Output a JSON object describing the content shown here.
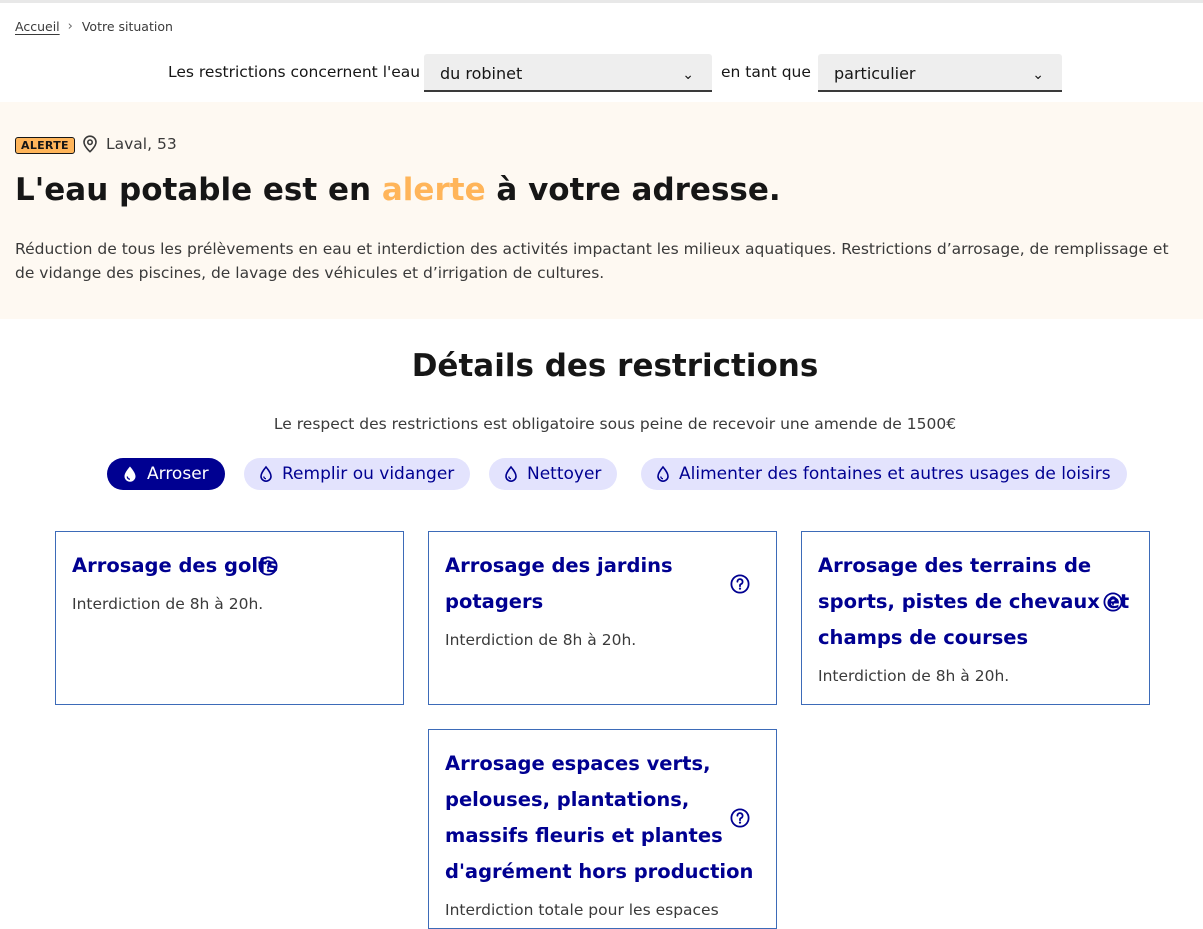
{
  "breadcrumb": {
    "home": "Accueil",
    "current": "Votre situation"
  },
  "filters": {
    "prefix": "Les restrictions concernent l'eau",
    "water_type": "du robinet",
    "middle": "en tant que",
    "user_type": "particulier"
  },
  "alert": {
    "badge": "ALERTE",
    "location": "Laval, 53",
    "title_before": "L'eau potable est en ",
    "title_highlight": "alerte",
    "title_after": " à votre adresse.",
    "description": "Réduction de tous les prélèvements en eau et interdiction des activités impactant les milieux aquatiques. Restrictions d’arrosage, de remplissage et de vidange des piscines, de lavage des véhicules et d’irrigation de cultures."
  },
  "restrictions": {
    "title": "Détails des restrictions",
    "subtitle": "Le respect des restrictions est obligatoire sous peine de recevoir une amende de 1500€",
    "tags": [
      "Arroser",
      "Remplir ou vidanger",
      "Nettoyer",
      "Alimenter des fontaines et autres usages de loisirs"
    ],
    "active_tag": "Arroser",
    "cards": [
      {
        "title_lines": [
          "Arrosage des golfs"
        ],
        "text": "Interdiction de 8h à 20h."
      },
      {
        "title_lines": [
          "Arrosage des jardins",
          "potagers"
        ],
        "text": "Interdiction de 8h à 20h."
      },
      {
        "title_lines": [
          "Arrosage des terrains de",
          "sports, pistes de chevaux et",
          "champs de courses"
        ],
        "text": "Interdiction de 8h à 20h."
      },
      {
        "title_lines": [
          "Arrosage espaces verts,",
          "pelouses, plantations,",
          "massifs fleuris et plantes",
          "d'agrément hors production"
        ],
        "text": "Interdiction totale pour les espaces"
      }
    ]
  },
  "colors": {
    "accent": "#000091",
    "alert": "#ffb55a",
    "alert_bg": "#fef9f2",
    "tag_bg": "#e3e3fd"
  },
  "icons": {
    "location": "map-pin-icon",
    "drop": "water-drop-icon",
    "help": "question-circle-icon",
    "chevron": "chevron-down-icon"
  }
}
